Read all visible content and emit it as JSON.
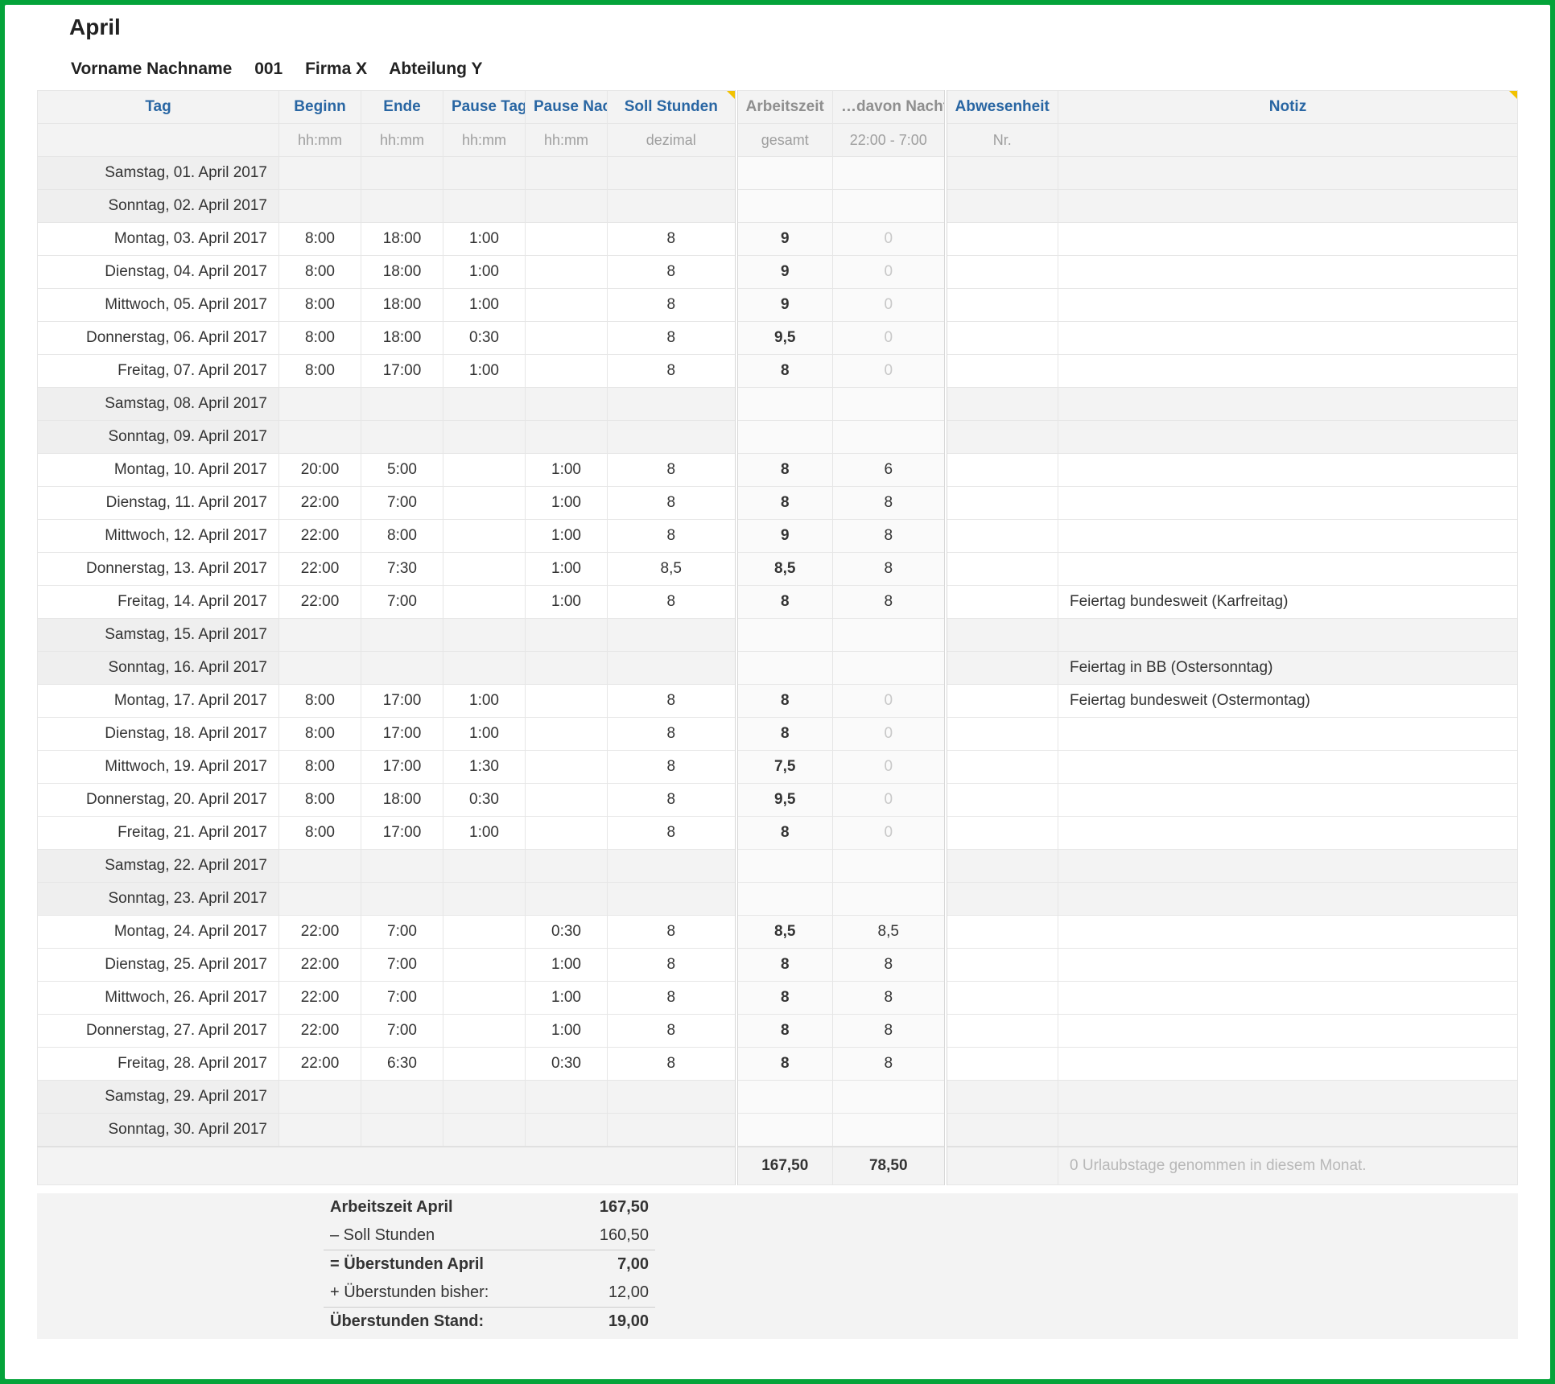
{
  "title": "April",
  "meta": {
    "name": "Vorname Nachname",
    "id": "001",
    "company": "Firma X",
    "dept": "Abteilung Y"
  },
  "headers": {
    "day": "Tag",
    "begin": "Beginn",
    "end": "Ende",
    "pauseDay": "Pause Tag",
    "pauseNight": "Pause Nacht",
    "soll": "Soll Stunden",
    "work": "Arbeitszeit",
    "night": "…davon Nachtzeit",
    "abw": "Abwesenheit",
    "note": "Notiz"
  },
  "subheaders": {
    "day": "",
    "begin": "hh:mm",
    "end": "hh:mm",
    "pauseDay": "hh:mm",
    "pauseNight": "hh:mm",
    "soll": "dezimal",
    "work": "gesamt",
    "night": "22:00 - 7:00",
    "abw": "Nr.",
    "note": ""
  },
  "rows": [
    {
      "day": "Samstag, 01. April 2017",
      "weekend": true
    },
    {
      "day": "Sonntag, 02. April 2017",
      "weekend": true
    },
    {
      "day": "Montag, 03. April 2017",
      "begin": "8:00",
      "end": "18:00",
      "pauseDay": "1:00",
      "soll": "8",
      "work": "9",
      "night": "0",
      "nightZero": true
    },
    {
      "day": "Dienstag, 04. April 2017",
      "begin": "8:00",
      "end": "18:00",
      "pauseDay": "1:00",
      "soll": "8",
      "work": "9",
      "night": "0",
      "nightZero": true
    },
    {
      "day": "Mittwoch, 05. April 2017",
      "begin": "8:00",
      "end": "18:00",
      "pauseDay": "1:00",
      "soll": "8",
      "work": "9",
      "night": "0",
      "nightZero": true
    },
    {
      "day": "Donnerstag, 06. April 2017",
      "begin": "8:00",
      "end": "18:00",
      "pauseDay": "0:30",
      "soll": "8",
      "work": "9,5",
      "night": "0",
      "nightZero": true
    },
    {
      "day": "Freitag, 07. April 2017",
      "begin": "8:00",
      "end": "17:00",
      "pauseDay": "1:00",
      "soll": "8",
      "work": "8",
      "night": "0",
      "nightZero": true
    },
    {
      "day": "Samstag, 08. April 2017",
      "weekend": true
    },
    {
      "day": "Sonntag, 09. April 2017",
      "weekend": true
    },
    {
      "day": "Montag, 10. April 2017",
      "begin": "20:00",
      "end": "5:00",
      "pauseNight": "1:00",
      "soll": "8",
      "work": "8",
      "night": "6"
    },
    {
      "day": "Dienstag, 11. April 2017",
      "begin": "22:00",
      "end": "7:00",
      "pauseNight": "1:00",
      "soll": "8",
      "work": "8",
      "night": "8"
    },
    {
      "day": "Mittwoch, 12. April 2017",
      "begin": "22:00",
      "end": "8:00",
      "pauseNight": "1:00",
      "soll": "8",
      "work": "9",
      "night": "8"
    },
    {
      "day": "Donnerstag, 13. April 2017",
      "begin": "22:00",
      "end": "7:30",
      "pauseNight": "1:00",
      "soll": "8,5",
      "work": "8,5",
      "night": "8"
    },
    {
      "day": "Freitag, 14. April 2017",
      "begin": "22:00",
      "end": "7:00",
      "pauseNight": "1:00",
      "soll": "8",
      "work": "8",
      "night": "8",
      "note": "Feiertag bundesweit (Karfreitag)"
    },
    {
      "day": "Samstag, 15. April 2017",
      "weekend": true
    },
    {
      "day": "Sonntag, 16. April 2017",
      "weekend": true,
      "note": "Feiertag in BB (Ostersonntag)"
    },
    {
      "day": "Montag, 17. April 2017",
      "begin": "8:00",
      "end": "17:00",
      "pauseDay": "1:00",
      "soll": "8",
      "work": "8",
      "night": "0",
      "nightZero": true,
      "note": "Feiertag bundesweit (Ostermontag)"
    },
    {
      "day": "Dienstag, 18. April 2017",
      "begin": "8:00",
      "end": "17:00",
      "pauseDay": "1:00",
      "soll": "8",
      "work": "8",
      "night": "0",
      "nightZero": true
    },
    {
      "day": "Mittwoch, 19. April 2017",
      "begin": "8:00",
      "end": "17:00",
      "pauseDay": "1:30",
      "soll": "8",
      "work": "7,5",
      "night": "0",
      "nightZero": true
    },
    {
      "day": "Donnerstag, 20. April 2017",
      "begin": "8:00",
      "end": "18:00",
      "pauseDay": "0:30",
      "soll": "8",
      "work": "9,5",
      "night": "0",
      "nightZero": true
    },
    {
      "day": "Freitag, 21. April 2017",
      "begin": "8:00",
      "end": "17:00",
      "pauseDay": "1:00",
      "soll": "8",
      "work": "8",
      "night": "0",
      "nightZero": true
    },
    {
      "day": "Samstag, 22. April 2017",
      "weekend": true
    },
    {
      "day": "Sonntag, 23. April 2017",
      "weekend": true
    },
    {
      "day": "Montag, 24. April 2017",
      "begin": "22:00",
      "end": "7:00",
      "pauseNight": "0:30",
      "soll": "8",
      "work": "8,5",
      "night": "8,5"
    },
    {
      "day": "Dienstag, 25. April 2017",
      "begin": "22:00",
      "end": "7:00",
      "pauseNight": "1:00",
      "soll": "8",
      "work": "8",
      "night": "8"
    },
    {
      "day": "Mittwoch, 26. April 2017",
      "begin": "22:00",
      "end": "7:00",
      "pauseNight": "1:00",
      "soll": "8",
      "work": "8",
      "night": "8"
    },
    {
      "day": "Donnerstag, 27. April 2017",
      "begin": "22:00",
      "end": "7:00",
      "pauseNight": "1:00",
      "soll": "8",
      "work": "8",
      "night": "8"
    },
    {
      "day": "Freitag, 28. April 2017",
      "begin": "22:00",
      "end": "6:30",
      "pauseNight": "0:30",
      "soll": "8",
      "work": "8",
      "night": "8"
    },
    {
      "day": "Samstag, 29. April 2017",
      "weekend": true
    },
    {
      "day": "Sonntag, 30. April 2017",
      "weekend": true
    }
  ],
  "totals": {
    "work": "167,50",
    "night": "78,50",
    "note": "0 Urlaubstage genommen in diesem Monat."
  },
  "summary": [
    {
      "label": "Arbeitszeit April",
      "value": "167,50",
      "bold": true
    },
    {
      "label": "– Soll Stunden",
      "value": "160,50"
    },
    {
      "label": "= Überstunden April",
      "value": "7,00",
      "bold": true,
      "divider": true
    },
    {
      "label": "+ Überstunden bisher:",
      "value": "12,00"
    },
    {
      "label": "Überstunden Stand:",
      "value": "19,00",
      "bold": true,
      "divider": true
    }
  ]
}
